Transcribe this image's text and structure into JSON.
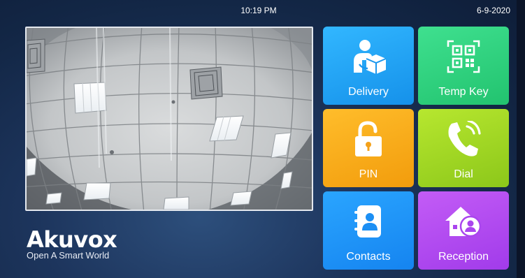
{
  "status_bar": {
    "time": "10:19 PM",
    "date": "6-9-2020"
  },
  "camera": {
    "feed": "ceiling view"
  },
  "brand": {
    "logo": "Akuvox",
    "tagline": "Open A Smart World"
  },
  "tiles": [
    {
      "label": "Delivery",
      "icon": "delivery-person-icon",
      "color": "#1fa3f7"
    },
    {
      "label": "Temp Key",
      "icon": "qr-code-icon",
      "color": "#2fd47e"
    },
    {
      "label": "PIN",
      "icon": "padlock-open-icon",
      "color": "#f8ab19"
    },
    {
      "label": "Dial",
      "icon": "phone-ringing-icon",
      "color": "#a2d823"
    },
    {
      "label": "Contacts",
      "icon": "address-book-icon",
      "color": "#1f95f8"
    },
    {
      "label": "Reception",
      "icon": "house-person-icon",
      "color": "#b34bf0"
    }
  ]
}
